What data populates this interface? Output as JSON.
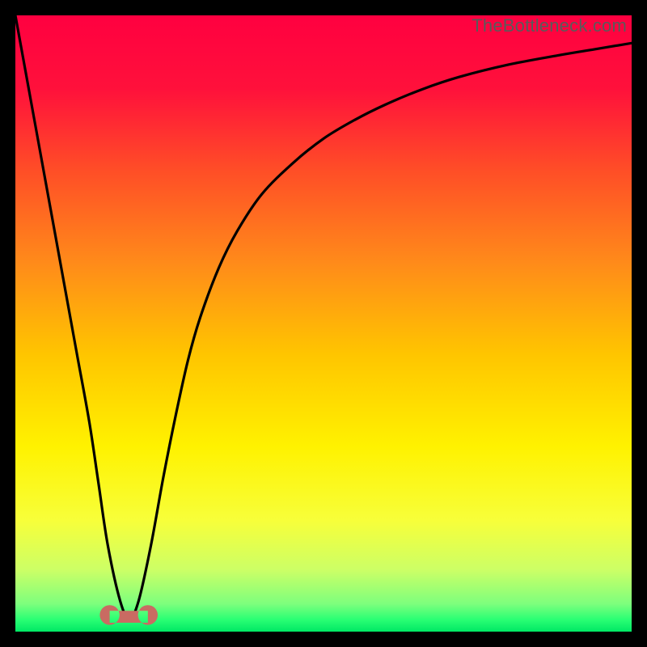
{
  "watermark": "TheBottleneck.com",
  "chart_data": {
    "type": "line",
    "title": "",
    "xlabel": "",
    "ylabel": "",
    "xlim": [
      0,
      100
    ],
    "ylim": [
      0,
      100
    ],
    "grid": false,
    "background_gradient": {
      "stops": [
        {
          "pos": 0.0,
          "color": "#ff0040"
        },
        {
          "pos": 0.12,
          "color": "#ff113b"
        },
        {
          "pos": 0.25,
          "color": "#ff4d27"
        },
        {
          "pos": 0.4,
          "color": "#ff8a1a"
        },
        {
          "pos": 0.55,
          "color": "#ffc500"
        },
        {
          "pos": 0.7,
          "color": "#fff200"
        },
        {
          "pos": 0.82,
          "color": "#f7ff3a"
        },
        {
          "pos": 0.9,
          "color": "#ccff66"
        },
        {
          "pos": 0.955,
          "color": "#7dff7d"
        },
        {
          "pos": 0.98,
          "color": "#2bff74"
        },
        {
          "pos": 1.0,
          "color": "#00e865"
        }
      ]
    },
    "series": [
      {
        "name": "bottleneck-curve",
        "color": "#000000",
        "x": [
          0,
          2,
          4,
          6,
          8,
          10,
          12,
          13.5,
          15,
          17,
          18.5,
          20,
          22,
          24,
          26,
          28,
          30,
          33,
          36,
          40,
          45,
          50,
          55,
          60,
          66,
          72,
          80,
          88,
          94,
          100
        ],
        "y": [
          100,
          89,
          78,
          67,
          56,
          45,
          34,
          24,
          14,
          5,
          2,
          5,
          14,
          25,
          35,
          44,
          51,
          59,
          65,
          71,
          76,
          80,
          83,
          85.5,
          88,
          90,
          92,
          93.5,
          94.5,
          95.5
        ]
      }
    ],
    "marker": {
      "name": "optimal-range-marker",
      "color": "#c96b62",
      "x_range": [
        15.3,
        21.5
      ],
      "y": 2.7,
      "lobe_radius_pct": 1.6
    }
  }
}
